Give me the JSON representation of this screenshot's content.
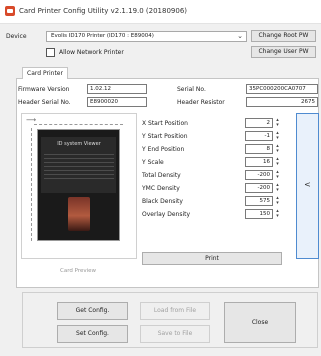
{
  "window": {
    "title": "Card Printer Config Utility v2.1.19.0 (20180906)"
  },
  "device": {
    "label": "Device",
    "selected": "Evolis ID170 Printer (ID170 : E89004)",
    "allow_network_label": "Allow Network Printer",
    "change_root_pw": "Change Root PW",
    "change_user_pw": "Change User PW"
  },
  "tabs": {
    "card_printer": "Card Printer"
  },
  "info": {
    "firmware_label": "Firmware Version",
    "firmware_value": "1.02.12",
    "serial_label": "Serial No.",
    "serial_value": "35PC000200CA0707",
    "header_serial_label": "Header Serial No.",
    "header_serial_value": "E8900020",
    "header_resistor_label": "Header Resistor",
    "header_resistor_value": "2675"
  },
  "preview": {
    "card_text": "ID system Viewer",
    "caption": "Card Preview"
  },
  "params": [
    {
      "label": "X Start Position",
      "value": "2"
    },
    {
      "label": "Y Start Position",
      "value": "-1"
    },
    {
      "label": "Y End Position",
      "value": "8"
    },
    {
      "label": "Y Scale",
      "value": "16"
    },
    {
      "label": "Total Density",
      "value": "-200"
    },
    {
      "label": "YMC Density",
      "value": "-200"
    },
    {
      "label": "Black Density",
      "value": "575"
    },
    {
      "label": "Overlay Density",
      "value": "150"
    }
  ],
  "buttons": {
    "print": "Print",
    "collapse": "<",
    "get_config": "Get Config.",
    "set_config": "Set Config.",
    "load_from_file": "Load from File",
    "save_to_file": "Save to File",
    "close": "Close"
  },
  "icons": {
    "app": "printer-app-icon",
    "dropdown": "chevron-down-icon",
    "spin": "spin-up-down-icon"
  },
  "colors": {
    "accent": "#4f8bd0",
    "app_icon": "#d84a2a"
  }
}
